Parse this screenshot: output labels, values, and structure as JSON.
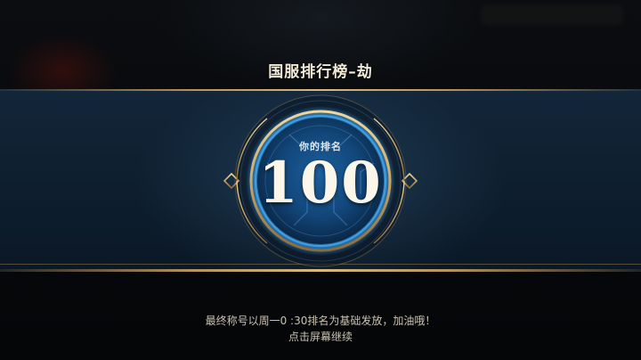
{
  "header": {
    "title": "国服排行榜–劫"
  },
  "rank": {
    "label": "你的排名",
    "value": "100"
  },
  "footer": {
    "note": "最终称号以周一0 :30排名为基础发放，加油哦！",
    "continue_hint": "点击屏幕继续"
  },
  "colors": {
    "gold_trim": "#c9a86a",
    "banner_blue": "#13263a",
    "ring_glow": "#2f8fd6",
    "text_light": "#f3ead7"
  }
}
